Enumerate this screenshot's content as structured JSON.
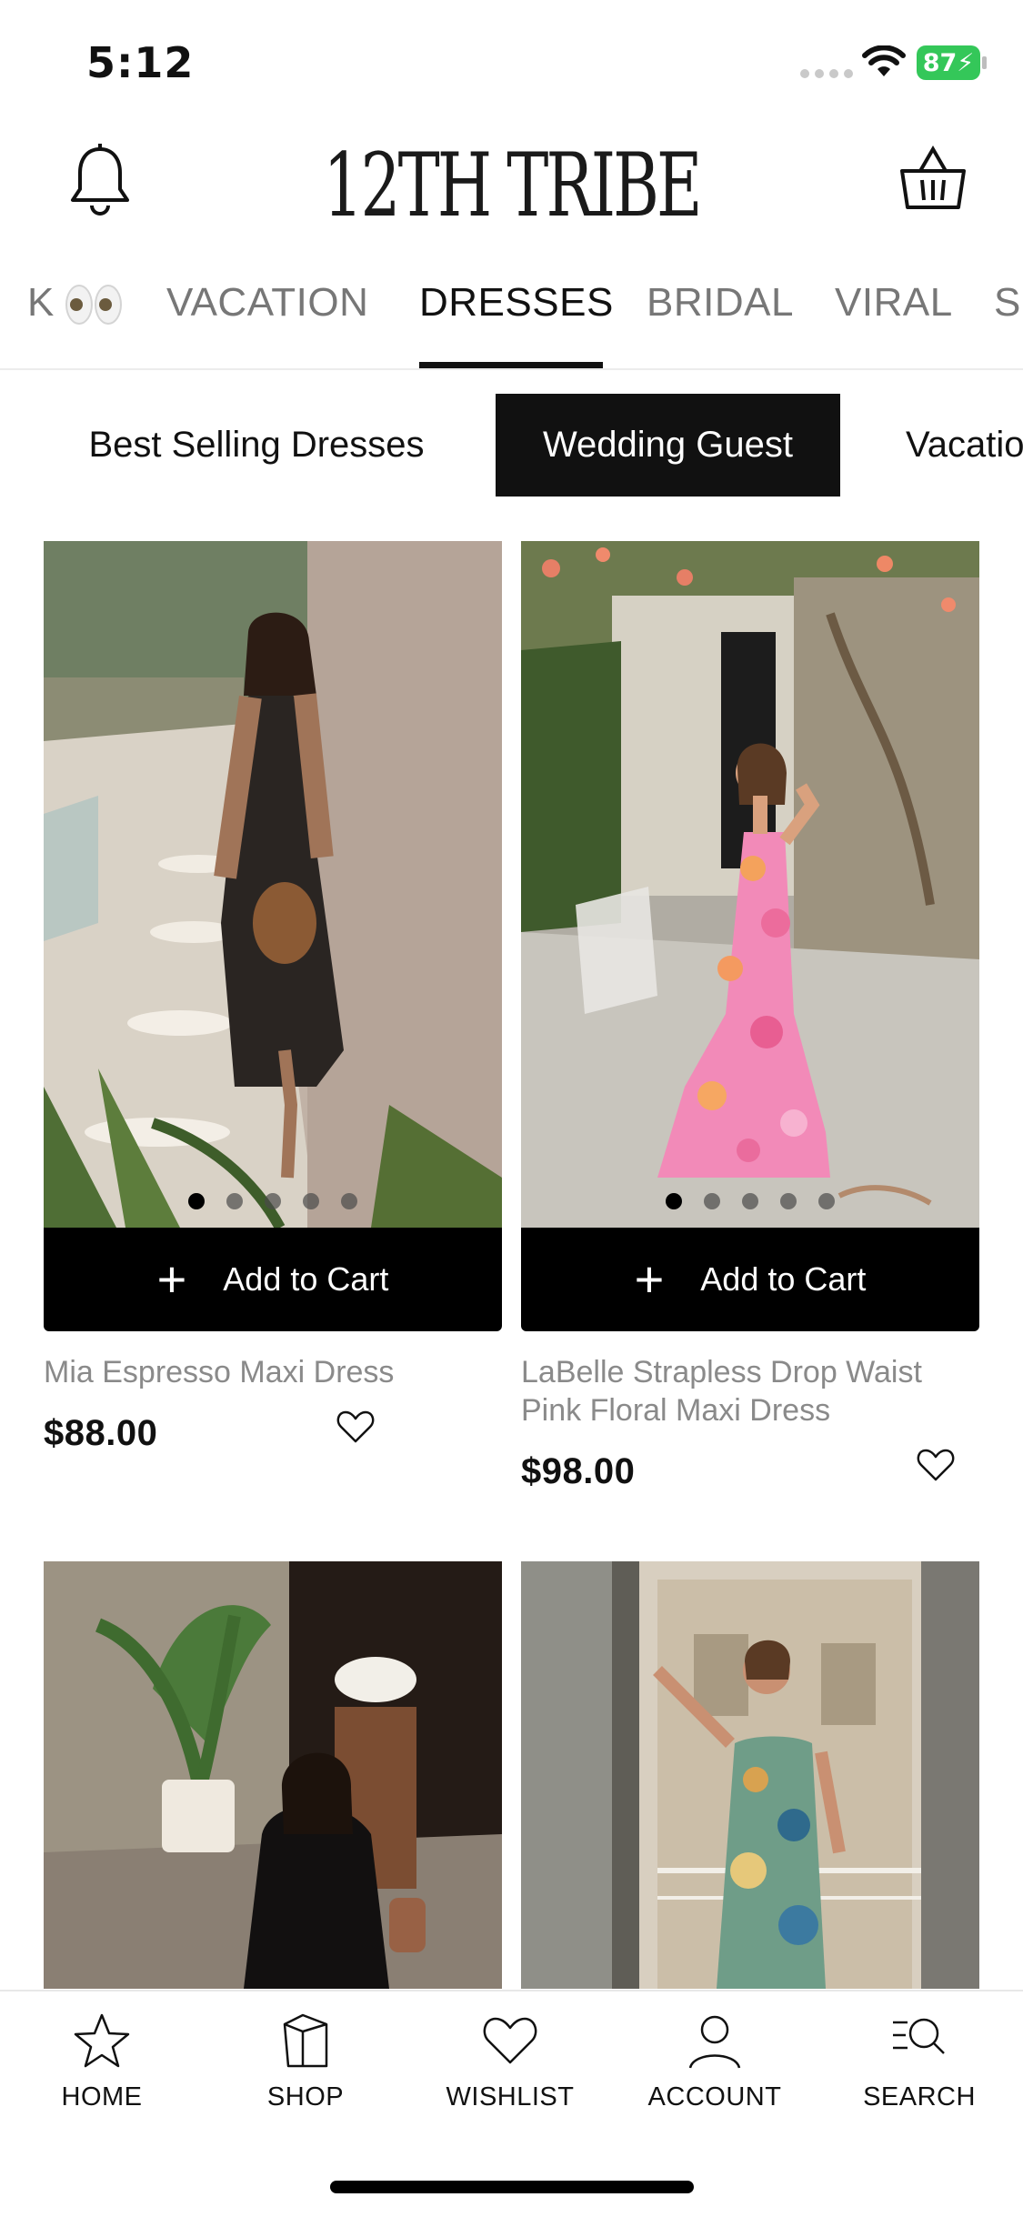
{
  "status": {
    "time": "5:12",
    "battery": "87"
  },
  "header": {
    "logo": "12TH TRIBE"
  },
  "category_tabs": [
    {
      "label": "K"
    },
    {
      "label": "VACATION"
    },
    {
      "label": "DRESSES",
      "active": true
    },
    {
      "label": "BRIDAL"
    },
    {
      "label": "VIRAL"
    },
    {
      "label": "S"
    }
  ],
  "chips": [
    {
      "label": "Best Selling Dresses"
    },
    {
      "label": "Wedding Guest",
      "active": true
    },
    {
      "label": "Vacatio"
    }
  ],
  "products": [
    {
      "name": "Mia Espresso Maxi Dress",
      "price": "$88.00",
      "add_label": "Add to Cart"
    },
    {
      "name": "LaBelle Strapless Drop Waist Pink Floral Maxi Dress",
      "price": "$98.00",
      "add_label": "Add to Cart"
    },
    {
      "name": "",
      "price": ""
    },
    {
      "name": "",
      "price": ""
    }
  ],
  "bottom_nav": [
    {
      "label": "HOME",
      "icon": "star-icon"
    },
    {
      "label": "SHOP",
      "icon": "shopping-bag-icon"
    },
    {
      "label": "WISHLIST",
      "icon": "heart-icon"
    },
    {
      "label": "ACCOUNT",
      "icon": "person-icon"
    },
    {
      "label": "SEARCH",
      "icon": "search-icon"
    }
  ]
}
